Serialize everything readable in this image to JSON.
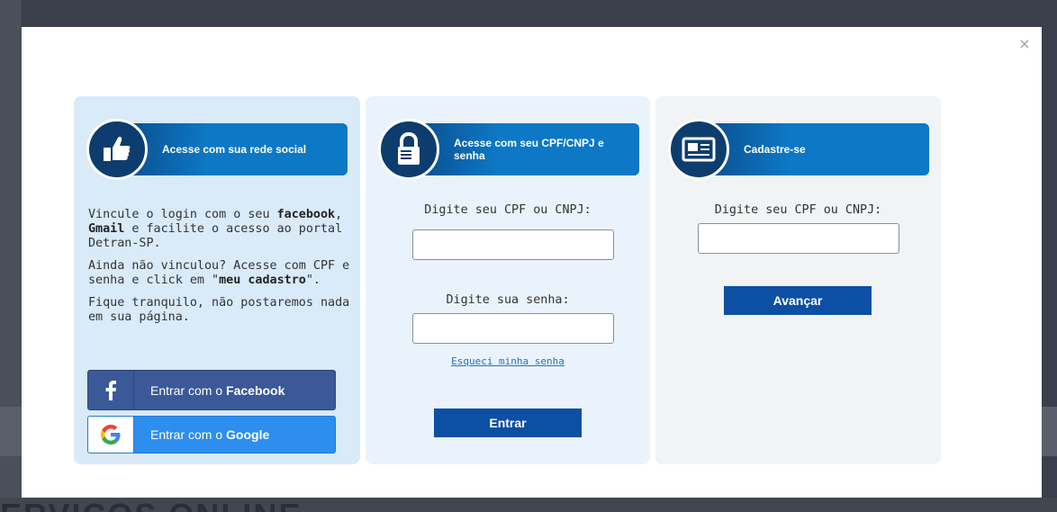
{
  "modal": {
    "close_label": "×"
  },
  "backdrop": {
    "partial_heading": "ERVIÇOS ONLINE"
  },
  "social": {
    "banner_title": "Acesse com sua rede social",
    "paragraph1_prefix": "Vincule o login com o seu ",
    "paragraph1_facebook": "facebook",
    "paragraph1_sep": ", ",
    "paragraph1_gmail": "Gmail",
    "paragraph1_suffix": " e facilite o acesso ao portal Detran-SP.",
    "paragraph2_prefix": "Ainda não vinculou? Acesse com CPF e senha e click em \"",
    "paragraph2_bold": "meu cadastro",
    "paragraph2_suffix": "\".",
    "paragraph3": "Fique tranquilo, não postaremos nada em sua página.",
    "facebook_button_prefix": "Entrar com o ",
    "facebook_button_brand": "Facebook",
    "google_button_prefix": "Entrar com o ",
    "google_button_brand": "Google",
    "icon": "thumbs-up-icon"
  },
  "login": {
    "banner_title": "Acesse com seu CPF/CNPJ e senha",
    "cpf_label": "Digite seu CPF ou CNPJ:",
    "cpf_value": "",
    "password_label": "Digite sua senha:",
    "password_value": "",
    "forgot_link": "Esqueci minha senha",
    "submit_label": "Entrar",
    "icon": "lock-icon"
  },
  "register": {
    "banner_title": "Cadastre-se",
    "cpf_label": "Digite seu CPF ou CNPJ:",
    "cpf_value": "",
    "submit_label": "Avançar",
    "icon": "id-card-icon"
  },
  "colors": {
    "banner_blue": "#0d78c6",
    "banner_dark": "#0d3d6e",
    "button_blue": "#0d4fa3",
    "facebook": "#3b5998",
    "google": "#2d8ef0",
    "link": "#1a73c5"
  }
}
